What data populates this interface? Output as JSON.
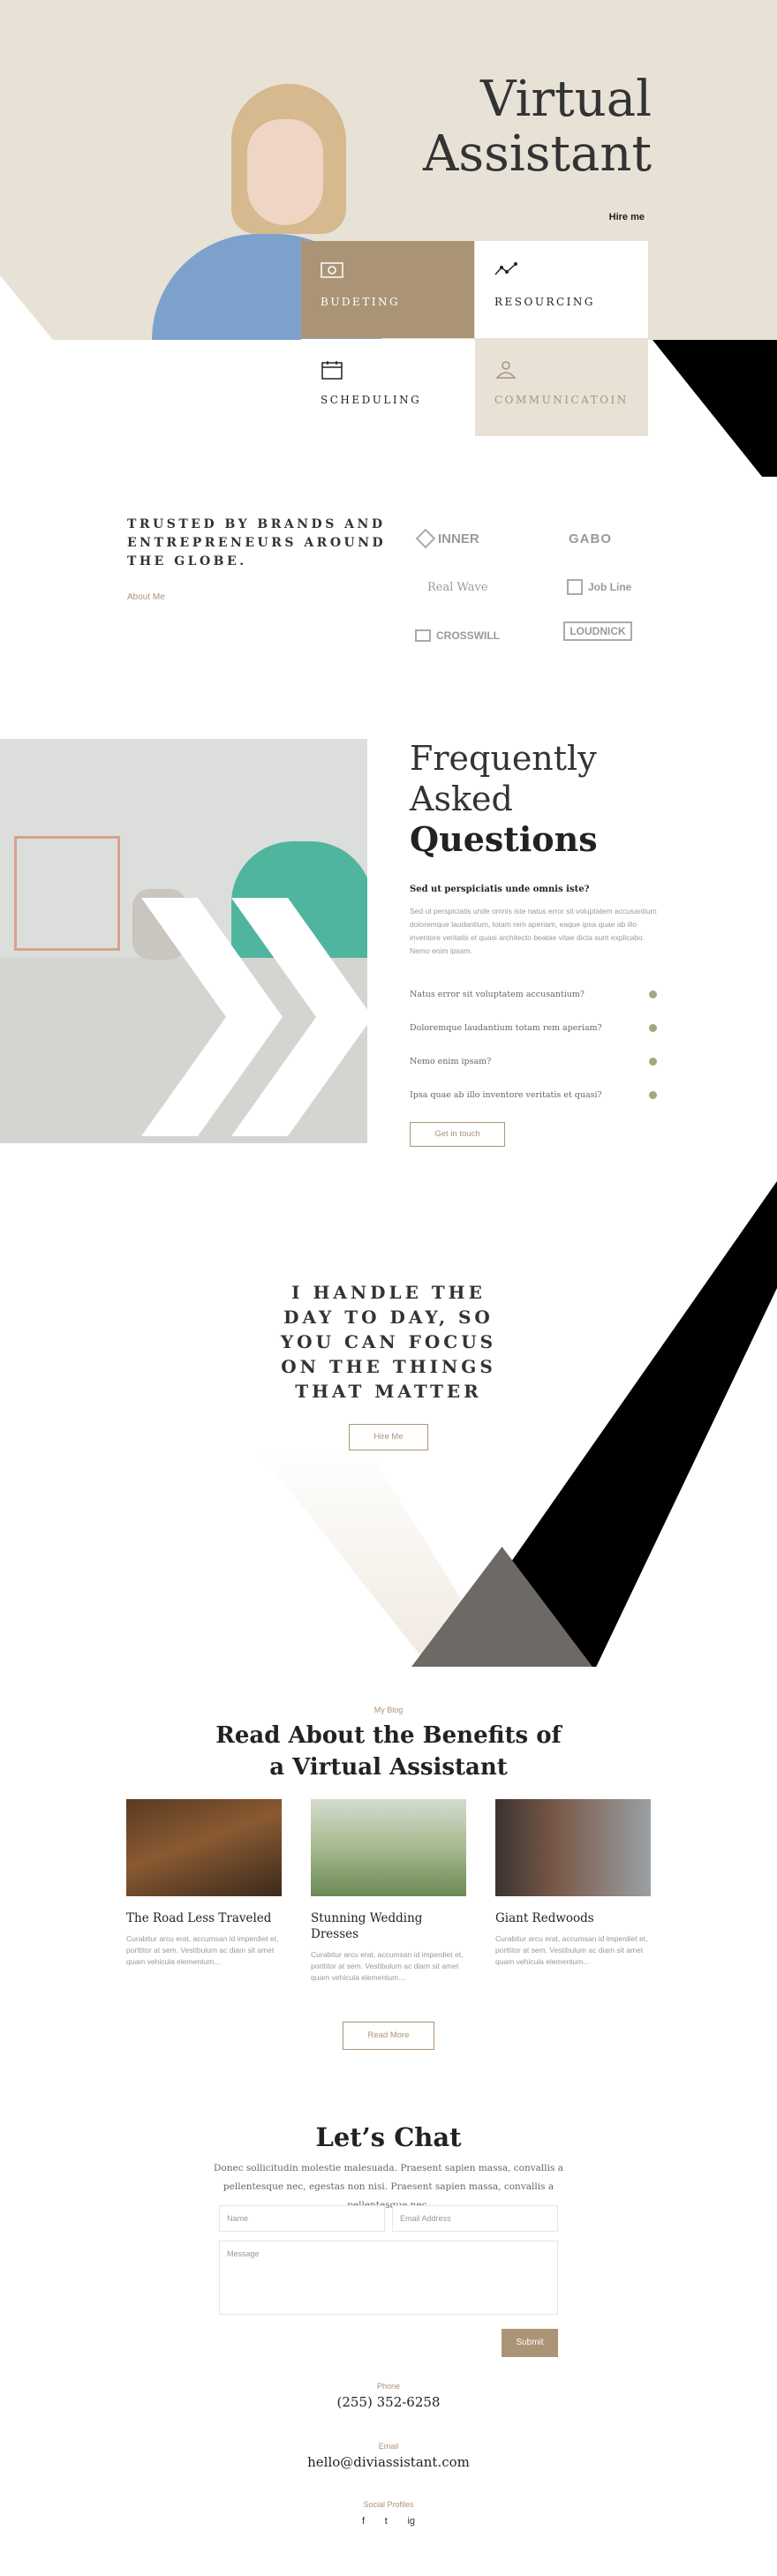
{
  "hero": {
    "title_line1": "Virtual",
    "title_line2": "Assistant",
    "hire_link": "Hire me",
    "tiles": [
      {
        "label": "BUDETING",
        "icon": "money-icon"
      },
      {
        "label": "RESOURCING",
        "icon": "resource-icon"
      },
      {
        "label": "SCHEDULING",
        "icon": "calendar-icon"
      },
      {
        "label": "COMMUNICATOIN",
        "icon": "people-icon"
      }
    ]
  },
  "trusted": {
    "heading": "TRUSTED BY BRANDS AND ENTREPRENEURS AROUND THE GLOBE.",
    "about_link": "About Me",
    "logos": [
      "INNER",
      "GABO",
      "Real Wave",
      "Job Line",
      "CROSSWILL",
      "LOUDNICK"
    ]
  },
  "faq": {
    "heading_line1": "Frequently",
    "heading_line2": "Asked",
    "heading_line3": "Questions",
    "open_question": "Sed ut perspiciatis unde omnis iste?",
    "open_answer": "Sed ut perspiciatis unde omnis iste natus error sit voluptatem accusantium doloremque laudantium, totam rem aperiam, eaque ipsa quae ab illo inventore veritatis et quasi architecto beatae vitae dicta sunt explicabo. Nemo enim ipsam.",
    "questions": [
      "Natus error sit voluptatem accusantium?",
      "Doloremque laudantium totam rem aperiam?",
      "Nemo enim ipsam?",
      "Ipsa quae ab illo inventore veritatis et quasi?"
    ],
    "button": "Get in touch"
  },
  "handle": {
    "heading": "I HANDLE THE DAY TO DAY, SO YOU CAN FOCUS ON THE THINGS THAT MATTER",
    "button": "Hire Me"
  },
  "blog": {
    "kicker": "My Blog",
    "heading": "Read About the Benefits of a Virtual Assistant",
    "posts": [
      {
        "title": "The Road Less Traveled",
        "excerpt": "Curabitur arcu erat, accumsan id imperdiet et, porttitor at sem. Vestibulum ac diam sit amet quam vehicula elementum..."
      },
      {
        "title": "Stunning Wedding Dresses",
        "excerpt": "Curabitur arcu erat, accumsan id imperdiet et, porttitor at sem. Vestibulum ac diam sit amet quam vehicula elementum..."
      },
      {
        "title": "Giant Redwoods",
        "excerpt": "Curabitur arcu erat, accumsan id imperdiet et, porttitor at sem. Vestibulum ac diam sit amet quam vehicula elementum..."
      }
    ],
    "button": "Read More"
  },
  "chat": {
    "heading": "Let’s Chat",
    "subtext": "Donec sollicitudin molestie malesuada. Praesent sapien massa, convallis a pellentesque nec, egestas non nisi. Praesent sapien massa, convallis a pellentesque nec.",
    "name_placeholder": "Name",
    "email_placeholder": "Email Address",
    "message_placeholder": "Message",
    "submit": "Submit"
  },
  "contact": {
    "phone_label": "Phone",
    "phone": "(255) 352-6258",
    "email_label": "Email",
    "email": "hello@diviassistant.com",
    "social_label": "Social Profiles",
    "socials": [
      "f",
      "t",
      "ig"
    ]
  },
  "colors": {
    "accent": "#ab9476",
    "beige": "#e8e1d6",
    "dark": "#222222"
  }
}
